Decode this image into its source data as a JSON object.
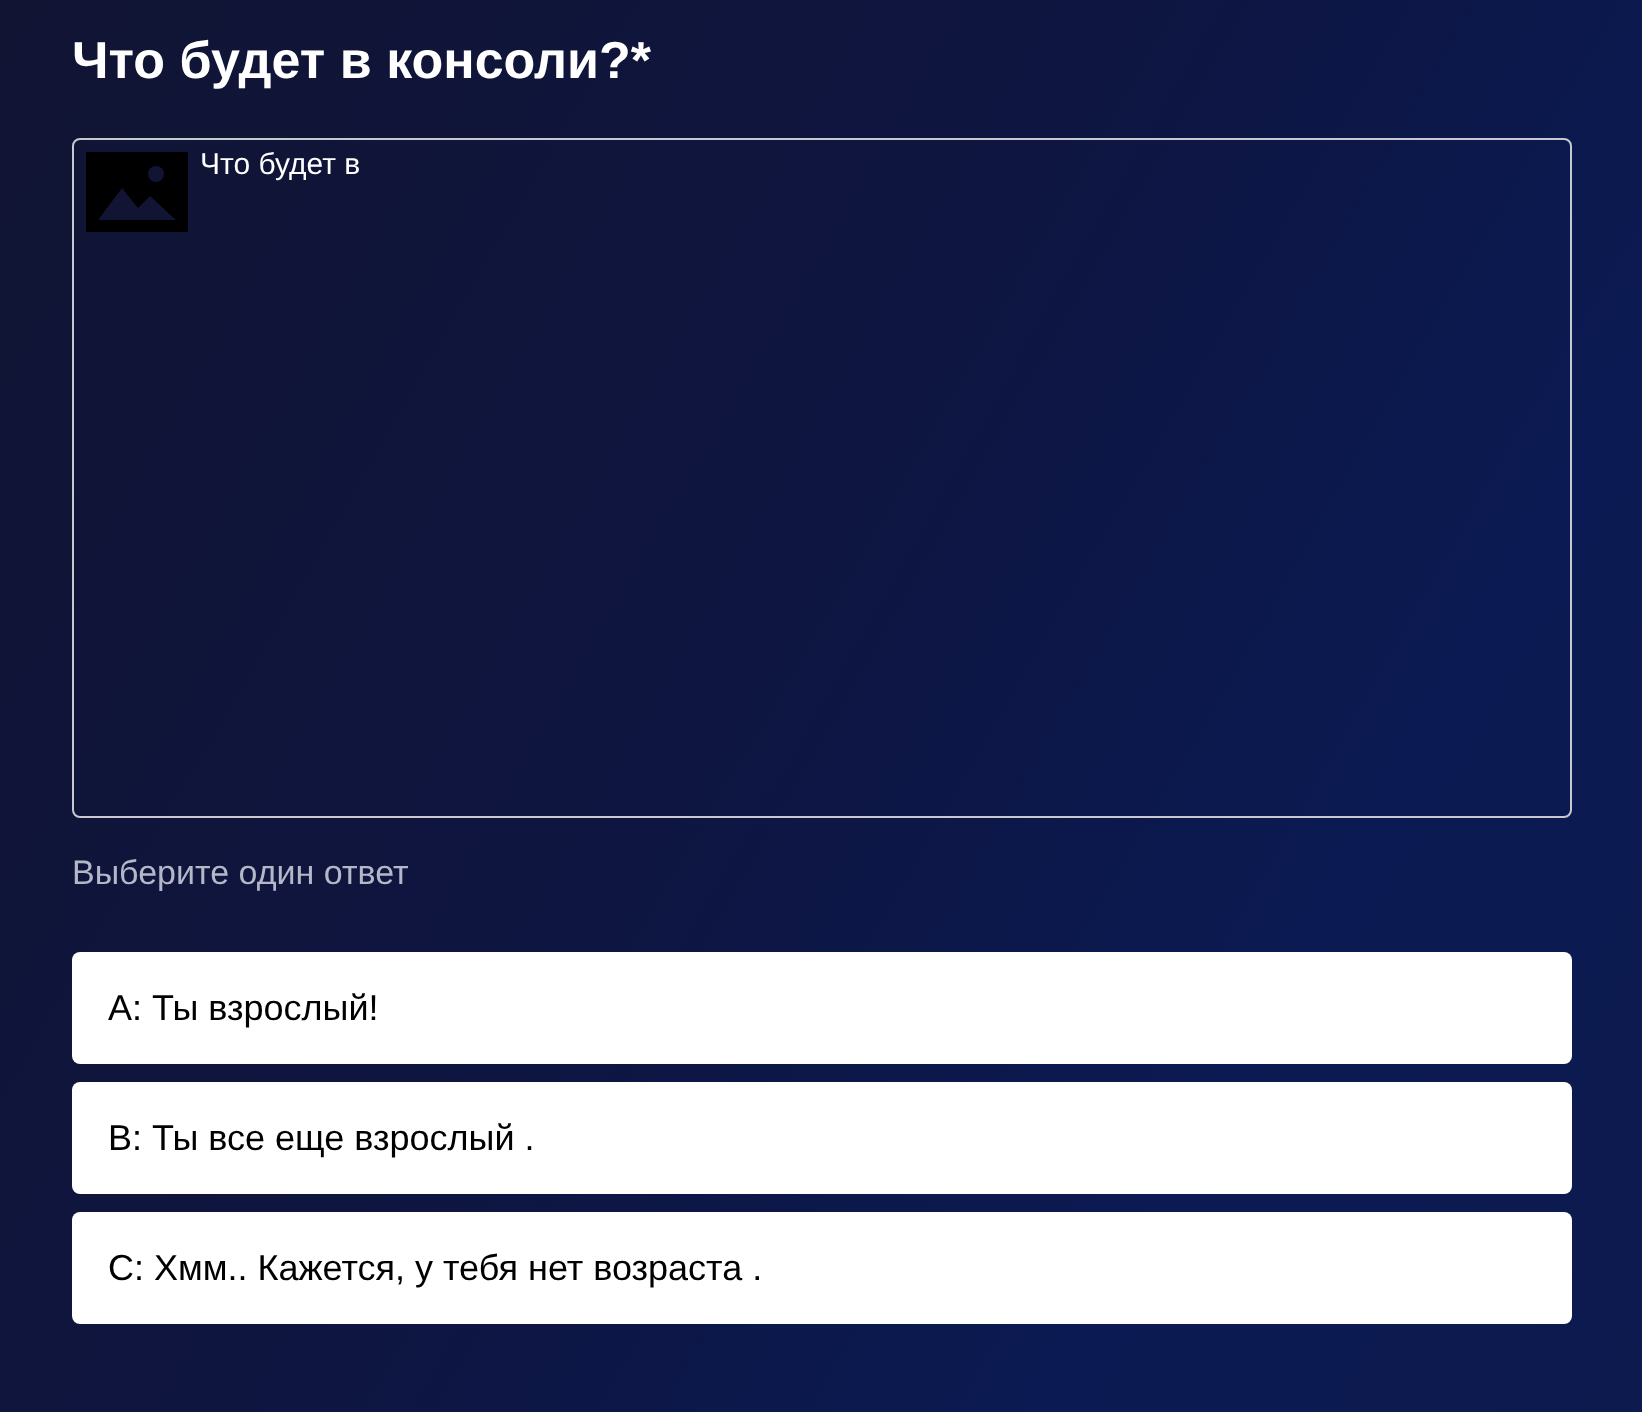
{
  "question": {
    "title": "Что будет в консоли?*",
    "image_alt": "Что будет в"
  },
  "hint": "Выберите один ответ",
  "options": [
    {
      "label": "A: Ты взрослый!"
    },
    {
      "label": "B: Ты все еще взрослый ."
    },
    {
      "label": "C: Хмм.. Кажется, у тебя нет возраста ."
    }
  ]
}
